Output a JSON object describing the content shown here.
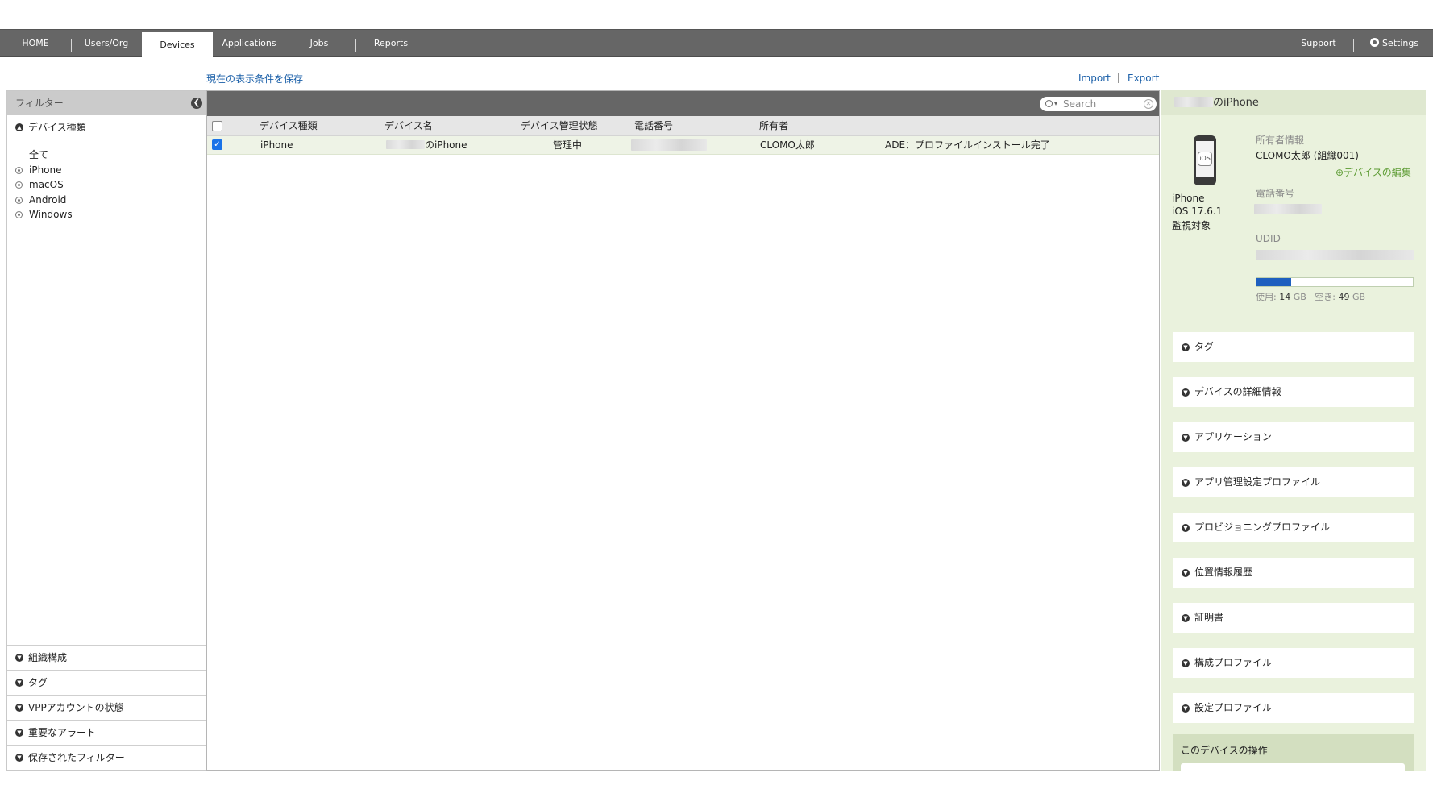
{
  "nav": {
    "items": [
      {
        "label": "HOME"
      },
      {
        "label": "Users/Org"
      },
      {
        "label": "Devices"
      },
      {
        "label": "Applications"
      },
      {
        "label": "Jobs"
      },
      {
        "label": "Reports"
      }
    ],
    "support": "Support",
    "settings": "Settings"
  },
  "toolbar": {
    "save_view": "現在の表示条件を保存",
    "import": "Import",
    "separator": "|",
    "export": "Export"
  },
  "filter": {
    "title": "フィルター",
    "device_type_section": "デバイス種類",
    "options": [
      {
        "label": "全て"
      },
      {
        "label": "iPhone"
      },
      {
        "label": "macOS"
      },
      {
        "label": "Android"
      },
      {
        "label": "Windows"
      }
    ],
    "bottom_sections": [
      {
        "label": "組織構成"
      },
      {
        "label": "タグ"
      },
      {
        "label": "VPPアカウントの状態"
      },
      {
        "label": "重要なアラート"
      },
      {
        "label": "保存されたフィルター"
      }
    ]
  },
  "search": {
    "placeholder": "Search"
  },
  "table": {
    "headers": [
      "デバイス種類",
      "デバイス名",
      "デバイス管理状態",
      "電話番号",
      "所有者"
    ],
    "rows": [
      {
        "type": "iPhone",
        "name_suffix": "のiPhone",
        "status": "管理中",
        "owner": "CLOMO太郎",
        "note": "ADE：プロファイルインストール完了",
        "checked": true
      }
    ]
  },
  "detail": {
    "title_suffix": "のiPhone",
    "os_badge": "iOS",
    "model": "iPhone",
    "os_version": "iOS 17.6.1",
    "supervised": "監視対象",
    "owner_label": "所有者情報",
    "owner_value": "CLOMO太郎 (組織001)",
    "edit_link": "デバイスの編集",
    "phone_label": "電話番号",
    "udid_label": "UDID",
    "storage": {
      "used_label": "使用:",
      "used_value": "14",
      "free_label": "空き:",
      "free_value": "49",
      "unit": "GB",
      "used_fraction": 0.22,
      "fill_color": "#1e5fbf"
    },
    "sections": [
      {
        "label": "タグ"
      },
      {
        "label": "デバイスの詳細情報"
      },
      {
        "label": "アプリケーション"
      },
      {
        "label": "アプリ管理設定プロファイル"
      },
      {
        "label": "プロビジョニングプロファイル"
      },
      {
        "label": "位置情報履歴"
      },
      {
        "label": "証明書"
      },
      {
        "label": "構成プロファイル"
      },
      {
        "label": "設定プロファイル"
      }
    ],
    "operations_title": "このデバイスの操作"
  },
  "colors": {
    "nav_bg": "#666666",
    "link": "#1a5fa8",
    "detail_bg": "#eaf2dd",
    "selected_row": "#eef3e6",
    "edit_link": "#5c9b32"
  }
}
